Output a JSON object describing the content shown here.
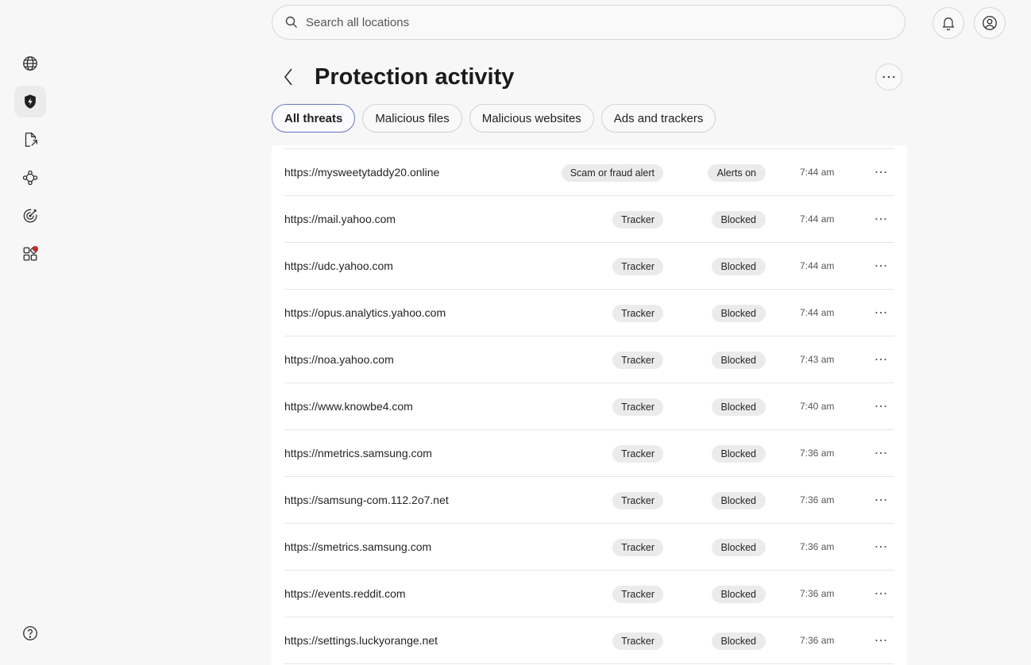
{
  "search": {
    "placeholder": "Search all locations"
  },
  "sidebar": {
    "items": [
      {
        "name": "globe-icon"
      },
      {
        "name": "shield-icon",
        "active": true
      },
      {
        "name": "document-share-icon"
      },
      {
        "name": "network-icon"
      },
      {
        "name": "target-icon"
      },
      {
        "name": "apps-icon",
        "badge": true
      }
    ],
    "help_icon": "question-circle-icon"
  },
  "header": {
    "title": "Protection activity"
  },
  "tabs": [
    {
      "label": "All threats",
      "active": true
    },
    {
      "label": "Malicious files"
    },
    {
      "label": "Malicious websites"
    },
    {
      "label": "Ads and trackers"
    }
  ],
  "rows": [
    {
      "url": "https://mysweetytaddy20.online",
      "type": "Scam or fraud alert",
      "status": "Alerts on",
      "time": "7:44 am"
    },
    {
      "url": "https://mail.yahoo.com",
      "type": "Tracker",
      "status": "Blocked",
      "time": "7:44 am"
    },
    {
      "url": "https://udc.yahoo.com",
      "type": "Tracker",
      "status": "Blocked",
      "time": "7:44 am"
    },
    {
      "url": "https://opus.analytics.yahoo.com",
      "type": "Tracker",
      "status": "Blocked",
      "time": "7:44 am"
    },
    {
      "url": "https://noa.yahoo.com",
      "type": "Tracker",
      "status": "Blocked",
      "time": "7:43 am"
    },
    {
      "url": "https://www.knowbe4.com",
      "type": "Tracker",
      "status": "Blocked",
      "time": "7:40 am"
    },
    {
      "url": "https://nmetrics.samsung.com",
      "type": "Tracker",
      "status": "Blocked",
      "time": "7:36 am"
    },
    {
      "url": "https://samsung-com.112.2o7.net",
      "type": "Tracker",
      "status": "Blocked",
      "time": "7:36 am"
    },
    {
      "url": "https://smetrics.samsung.com",
      "type": "Tracker",
      "status": "Blocked",
      "time": "7:36 am"
    },
    {
      "url": "https://events.reddit.com",
      "type": "Tracker",
      "status": "Blocked",
      "time": "7:36 am"
    },
    {
      "url": "https://settings.luckyorange.net",
      "type": "Tracker",
      "status": "Blocked",
      "time": "7:36 am"
    }
  ],
  "colors": {
    "accent_tab_border": "#6a73c7",
    "badge": "#c42b1c",
    "chip_bg": "#ebebeb"
  }
}
